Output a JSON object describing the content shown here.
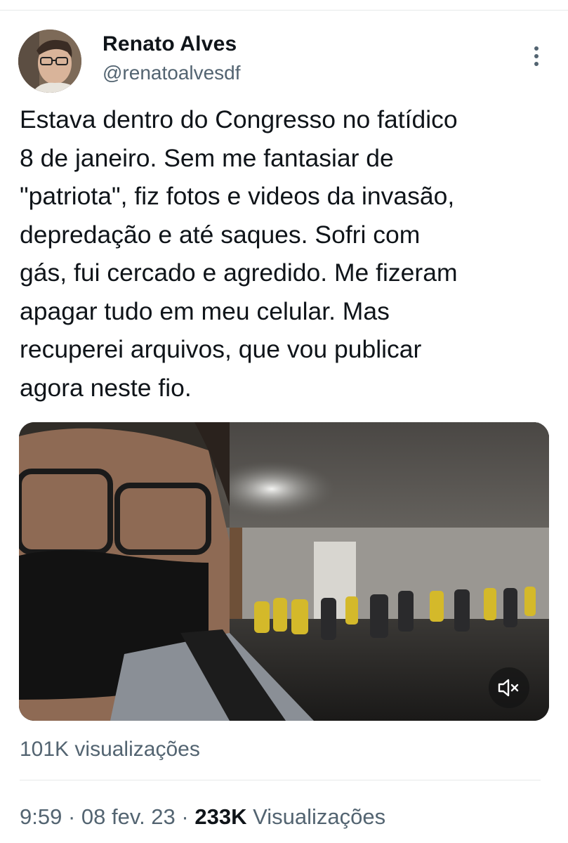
{
  "author": {
    "name": "Renato Alves",
    "handle": "@renatoalvesdf"
  },
  "tweet": {
    "text": "Estava dentro do Congresso no fatídico\n8 de janeiro. Sem me fantasiar de\n\"patriota\", fiz fotos e videos da invasão,\ndepredação e até saques. Sofri com\ngás, fui cercado e agredido. Me fizeram\napagar tudo em meu celular. Mas\nrecuperei arquivos, que vou publicar\nagora neste fio."
  },
  "media": {
    "type": "video",
    "icon": "muted-speaker-icon",
    "views_label": "101K visualizações"
  },
  "footer": {
    "time": "9:59",
    "separator": "·",
    "date": "08 fev. 23",
    "views_count": "233K",
    "views_word": "Visualizações"
  },
  "icons": {
    "more": "more-options-icon",
    "mute": "muted-speaker-icon"
  },
  "colors": {
    "text": "#0f1419",
    "secondary": "#536471",
    "divider": "#e7e9ea"
  }
}
